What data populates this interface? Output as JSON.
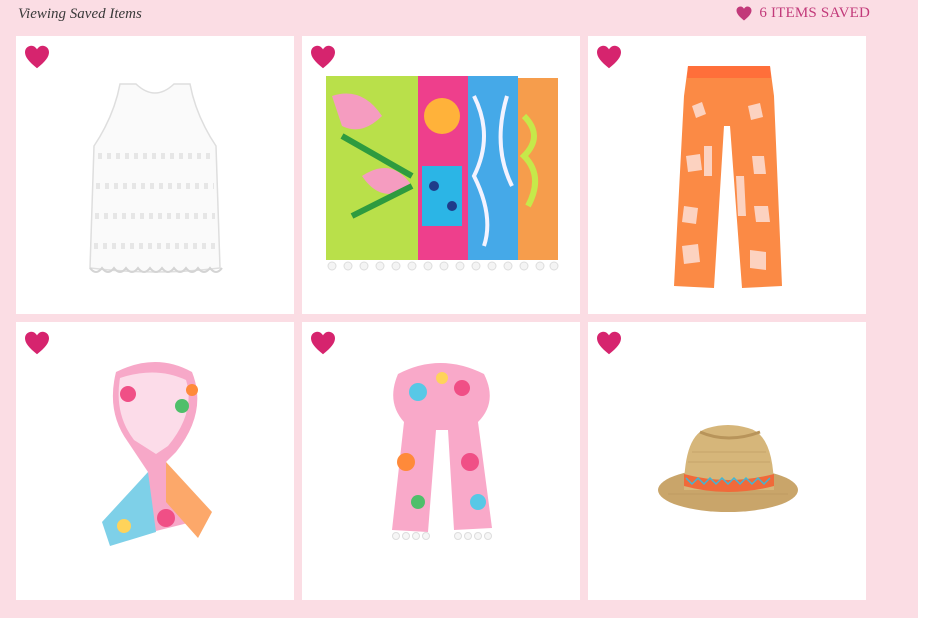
{
  "header": {
    "title": "Viewing Saved Items",
    "saved_count": "6 ITEMS SAVED"
  },
  "colors": {
    "background": "#fbdde4",
    "heart": "#d6246e",
    "accent_text": "#c23a7a"
  },
  "items": [
    {
      "icon": "heart-icon",
      "product": "white lace tank top"
    },
    {
      "icon": "heart-icon",
      "product": "printed beach towels"
    },
    {
      "icon": "heart-icon",
      "product": "orange giraffe print pants"
    },
    {
      "icon": "heart-icon",
      "product": "floral print scarf"
    },
    {
      "icon": "heart-icon",
      "product": "pom pom floral scarf"
    },
    {
      "icon": "heart-icon",
      "product": "straw fedora hat"
    }
  ]
}
